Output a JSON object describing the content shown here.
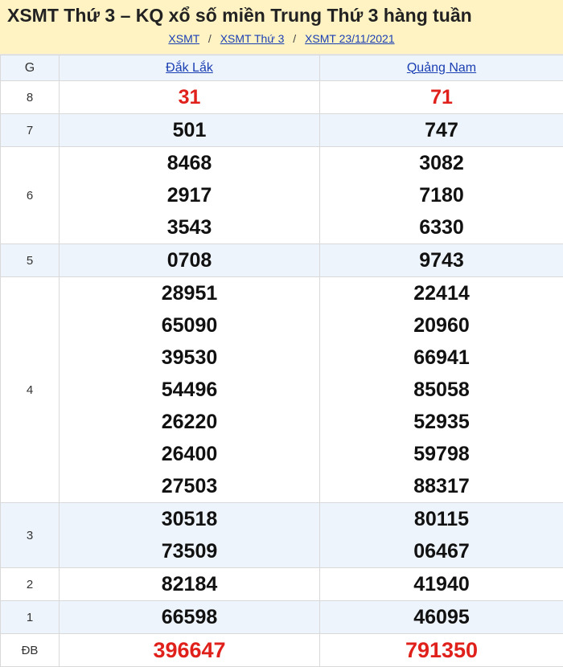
{
  "header": {
    "title": "XSMT Thứ 3 – KQ xổ số miền Trung Thứ 3 hàng tuần",
    "breadcrumbs": [
      "XSMT",
      "XSMT Thứ 3",
      "XSMT 23/11/2021"
    ],
    "separator": "/"
  },
  "table": {
    "prize_header": "G",
    "provinces": [
      "Đắk Lắk",
      "Quảng Nam"
    ],
    "rows": [
      {
        "prize": "8",
        "col1": [
          "31"
        ],
        "col2": [
          "71"
        ]
      },
      {
        "prize": "7",
        "col1": [
          "501"
        ],
        "col2": [
          "747"
        ]
      },
      {
        "prize": "6",
        "col1": [
          "8468",
          "2917",
          "3543"
        ],
        "col2": [
          "3082",
          "7180",
          "6330"
        ]
      },
      {
        "prize": "5",
        "col1": [
          "0708"
        ],
        "col2": [
          "9743"
        ]
      },
      {
        "prize": "4",
        "col1": [
          "28951",
          "65090",
          "39530",
          "54496",
          "26220",
          "26400",
          "27503"
        ],
        "col2": [
          "22414",
          "20960",
          "66941",
          "85058",
          "52935",
          "59798",
          "88317"
        ]
      },
      {
        "prize": "3",
        "col1": [
          "30518",
          "73509"
        ],
        "col2": [
          "80115",
          "06467"
        ]
      },
      {
        "prize": "2",
        "col1": [
          "82184"
        ],
        "col2": [
          "41940"
        ]
      },
      {
        "prize": "1",
        "col1": [
          "66598"
        ],
        "col2": [
          "46095"
        ]
      },
      {
        "prize": "ĐB",
        "col1": [
          "396647"
        ],
        "col2": [
          "791350"
        ]
      }
    ]
  },
  "colors": {
    "header_bg": "#fff3c4",
    "link": "#1a3fb3",
    "highlight_number": "#e0201b",
    "alt_row_bg": "#eef4fb"
  }
}
